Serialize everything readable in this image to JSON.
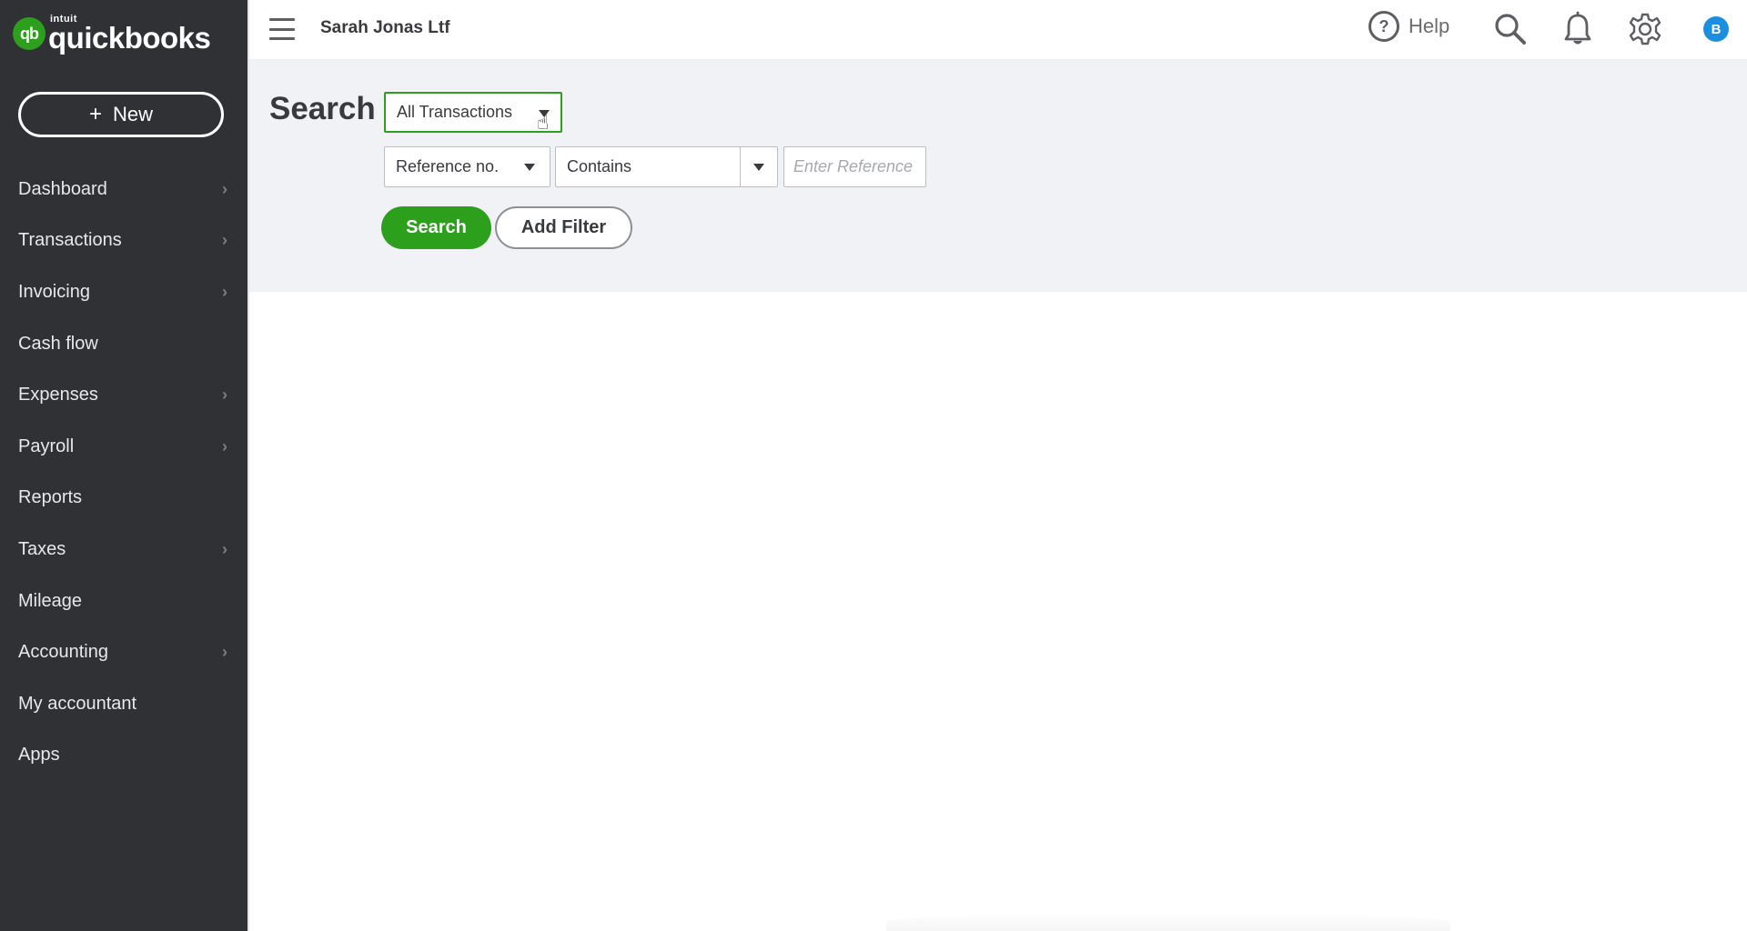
{
  "app": {
    "brand_prefix": "intuit",
    "brand_name": "quickbooks",
    "logo_monogram": "qb",
    "brand_color": "#2ca01c"
  },
  "sidebar": {
    "new_button": {
      "icon": "plus-icon",
      "icon_glyph": "+",
      "label": "New"
    },
    "items": [
      {
        "label": "Dashboard",
        "has_submenu": true
      },
      {
        "label": "Transactions",
        "has_submenu": true
      },
      {
        "label": "Invoicing",
        "has_submenu": true
      },
      {
        "label": "Cash flow",
        "has_submenu": false
      },
      {
        "label": "Expenses",
        "has_submenu": true
      },
      {
        "label": "Payroll",
        "has_submenu": true
      },
      {
        "label": "Reports",
        "has_submenu": false
      },
      {
        "label": "Taxes",
        "has_submenu": true
      },
      {
        "label": "Mileage",
        "has_submenu": false
      },
      {
        "label": "Accounting",
        "has_submenu": true
      },
      {
        "label": "My accountant",
        "has_submenu": false
      },
      {
        "label": "Apps",
        "has_submenu": false
      }
    ],
    "chevron_glyph": "›"
  },
  "header": {
    "company_name": "Sarah Jonas Ltf",
    "help_label": "Help",
    "help_glyph": "?",
    "avatar_initial": "B",
    "avatar_color": "#1a8fe0"
  },
  "search": {
    "title": "Search",
    "transaction_type": {
      "selected": "All Transactions"
    },
    "filter_field": {
      "selected": "Reference no."
    },
    "filter_condition": {
      "selected": "Contains"
    },
    "filter_value": {
      "value": "",
      "placeholder": "Enter Reference"
    },
    "search_button": "Search",
    "add_filter_button": "Add Filter"
  }
}
